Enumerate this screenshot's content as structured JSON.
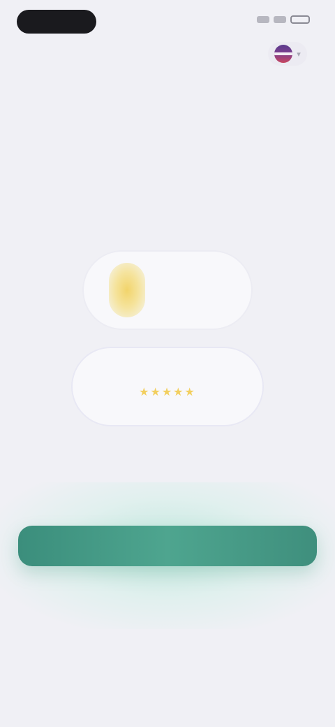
{
  "hero": {
    "line_before": "",
    "accent": "",
    "line_after": ""
  },
  "badges": {
    "rating_value": "",
    "rating_caption": "",
    "users_value": "",
    "users_caption": "",
    "stars": "★★★★★"
  },
  "cta": {
    "button_label": "",
    "login_link": ""
  },
  "footer": {
    "terms_prefix": "",
    "terms_link": "",
    "terms_middle": "",
    "privacy_link": ""
  },
  "colors": {
    "accent": "#5cbfa3",
    "primary_button": "#4ea58f",
    "background": "#f0f0f5"
  },
  "icons": {
    "language_flag": "flag-icon",
    "chevron": "chevron-down-icon",
    "laurel": "laurel-icon"
  }
}
